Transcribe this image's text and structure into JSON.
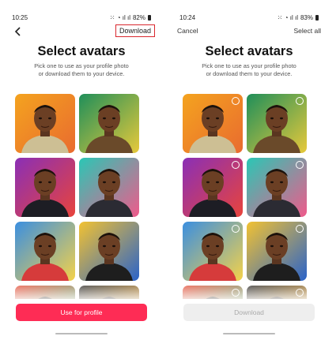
{
  "left": {
    "status": {
      "time": "10:25",
      "battery": "82%"
    },
    "download_label": "Download",
    "title": "Select avatars",
    "subtitle_line1": "Pick one to use as your profile photo",
    "subtitle_line2": "or download them to your device.",
    "primary_button": "Use for profile"
  },
  "right": {
    "status": {
      "time": "10:24",
      "battery": "83%"
    },
    "cancel_label": "Cancel",
    "select_all_label": "Select all",
    "title": "Select avatars",
    "subtitle_line1": "Pick one to use as your profile photo",
    "subtitle_line2": "or download them to your device.",
    "download_button": "Download"
  },
  "avatars": [
    {
      "name": "avatar-orange-floral",
      "bg1": "#f4a31f",
      "bg2": "#e96b2f",
      "shirt": "#cdbf94"
    },
    {
      "name": "avatar-green-neon",
      "bg1": "#1f8f5a",
      "bg2": "#e7c93b",
      "shirt": "#6a4a2a"
    },
    {
      "name": "avatar-purple-red",
      "bg1": "#8a2fb6",
      "bg2": "#e8443c",
      "shirt": "#1d1d24"
    },
    {
      "name": "avatar-teal-pink",
      "bg1": "#2ac7b5",
      "bg2": "#f05a8b",
      "shirt": "#2b2b33"
    },
    {
      "name": "avatar-watercolor",
      "bg1": "#3b8fe0",
      "bg2": "#f4d24a",
      "shirt": "#d63b3b"
    },
    {
      "name": "avatar-yellow-blue",
      "bg1": "#f2c232",
      "bg2": "#2a63c9",
      "shirt": "#1e1e1e"
    },
    {
      "name": "avatar-partial-green",
      "bg1": "#e94f3b",
      "bg2": "#3bb56b",
      "shirt": "#333"
    },
    {
      "name": "avatar-partial-yellow",
      "bg1": "#2c2c2c",
      "bg2": "#f5a623",
      "shirt": "#444"
    }
  ],
  "colors": {
    "accent": "#fe2c55",
    "outline": "#d9272e"
  }
}
